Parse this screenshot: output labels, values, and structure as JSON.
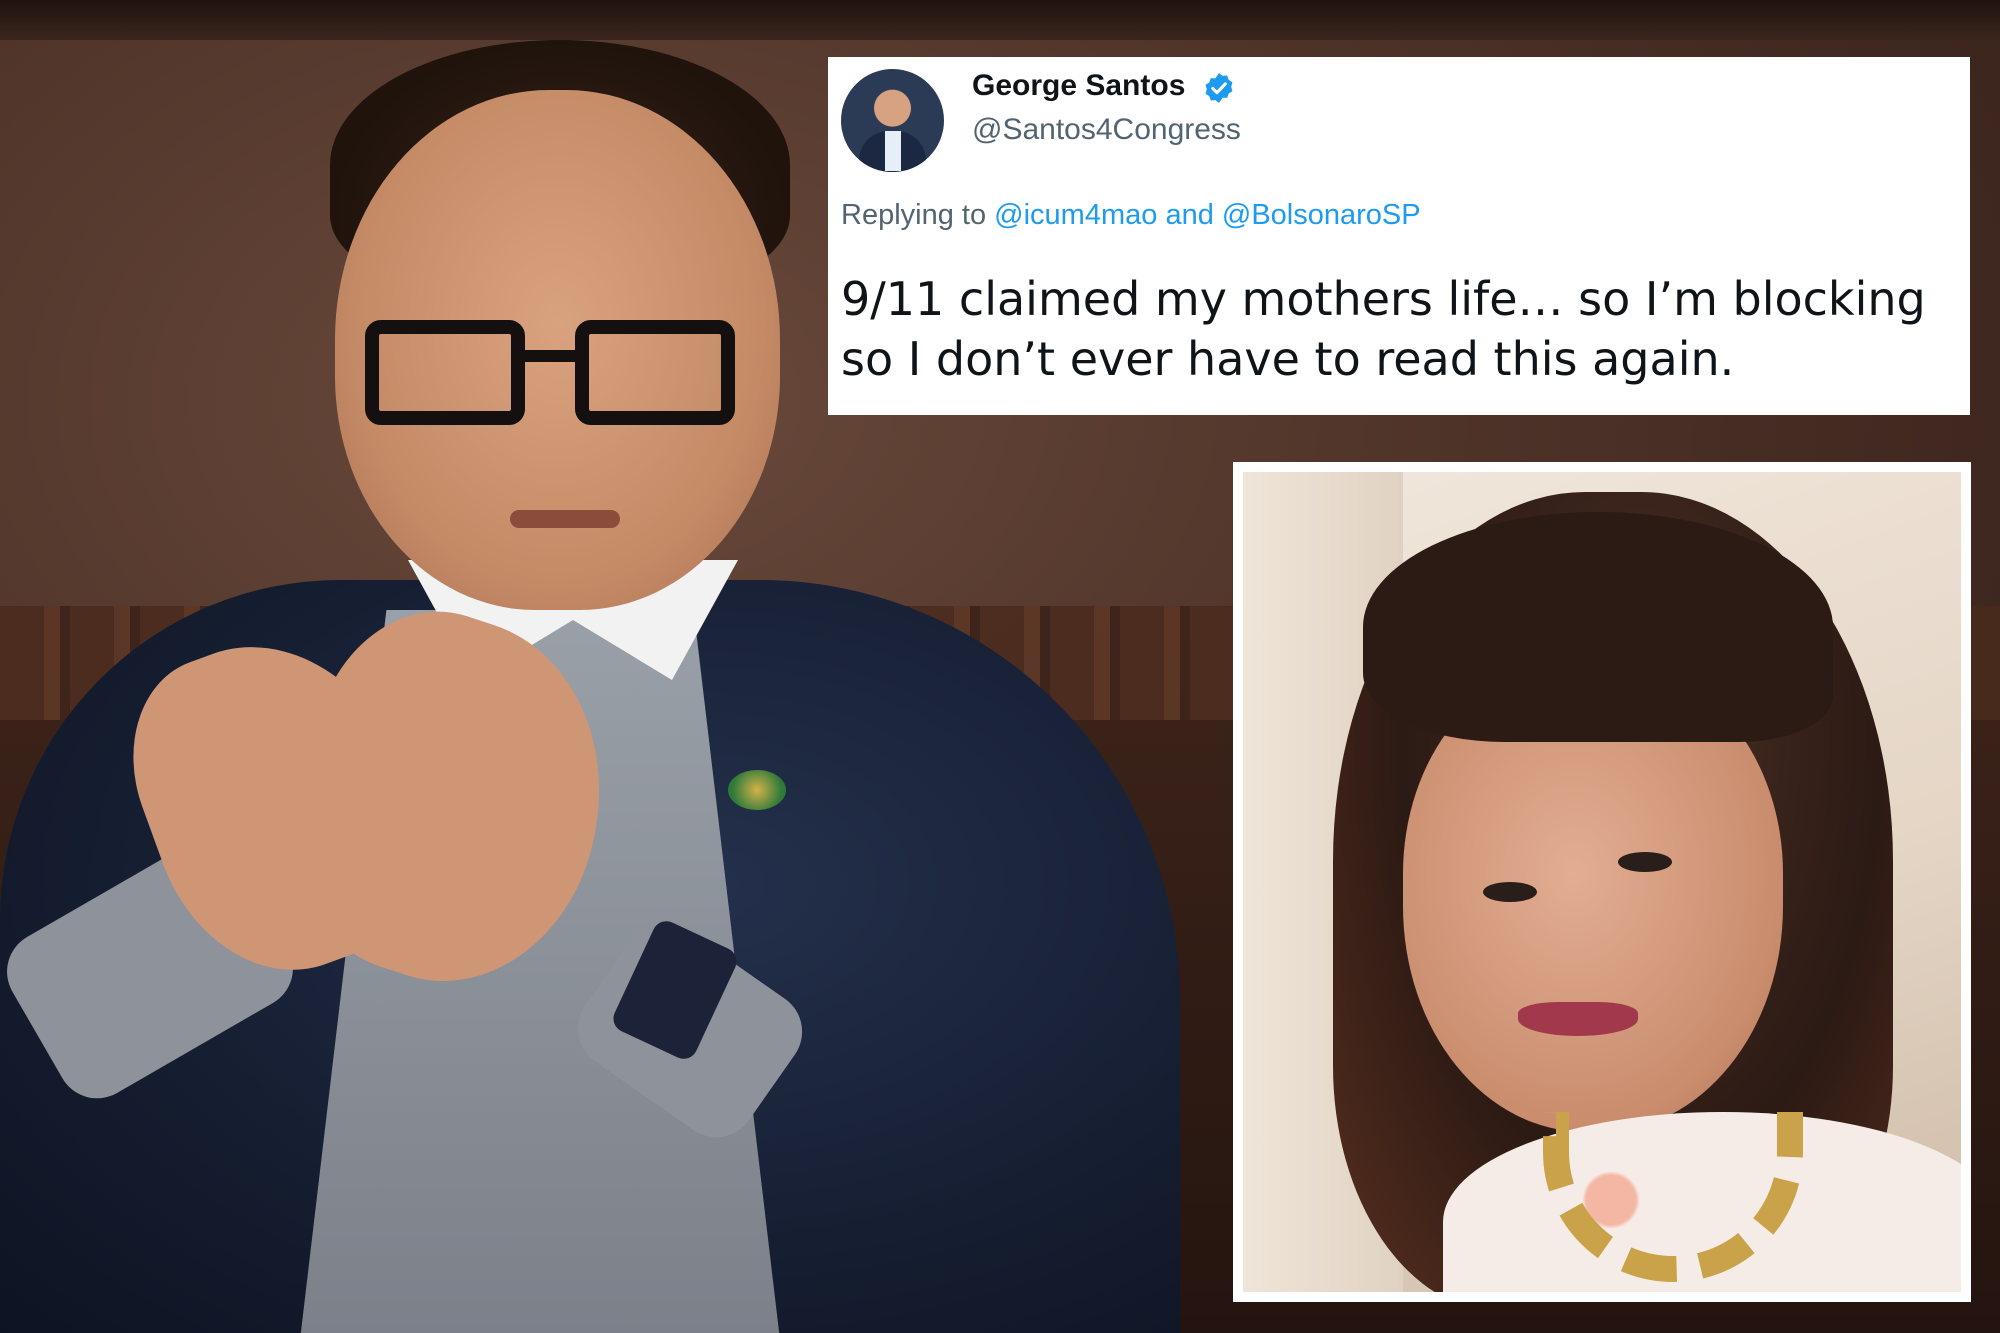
{
  "tweet": {
    "author_name": "George Santos",
    "verified_icon": "verified-badge-icon",
    "handle": "@Santos4Congress",
    "reply_prefix": "Replying to",
    "reply_mention_1": "@icum4mao",
    "reply_conjunction": "and",
    "reply_mention_2": "@BolsonaroSP",
    "text": "9/11 claimed my mothers life… so I’m blocking so I don’t ever have to read this again."
  },
  "colors": {
    "verified_blue": "#1d9bf0",
    "mention_blue": "#1d9bf0",
    "text_primary": "#0f1419",
    "text_secondary": "#536471"
  }
}
